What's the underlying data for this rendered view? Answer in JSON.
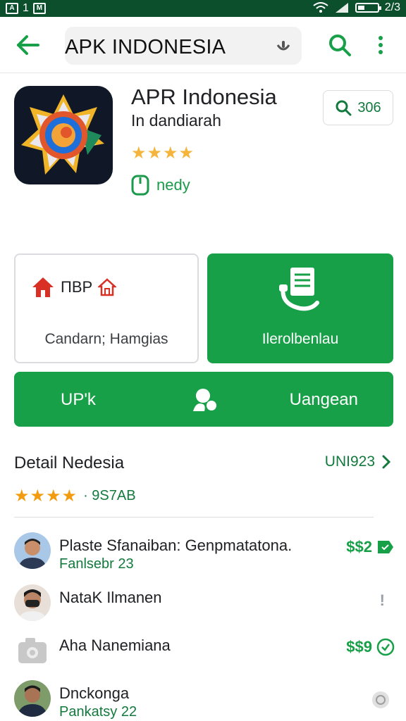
{
  "status_bar": {
    "left_text": "1",
    "time": "2/3",
    "battery_level": 0.35
  },
  "app_bar": {
    "search_query": "APK INDONESIA",
    "back_icon": "arrow-left-icon",
    "mic_icon": "mic-icon",
    "search_icon": "search-icon",
    "more_icon": "more-vert-icon"
  },
  "app": {
    "title": "APR Indonesia",
    "subtitle": "In dandiarah",
    "rating_stars": 4,
    "stars_text": "★★★★",
    "ready_text": "nedy",
    "size_label": "306"
  },
  "cards": {
    "left_brand": "ΠΒΡ",
    "left_caption": "Candarn; Hamgias",
    "right_caption": "Ilerolbenlau"
  },
  "wide_button": {
    "left_label": "UP'k",
    "right_label": "Uangean"
  },
  "details": {
    "title": "Detail Nedesia",
    "link_label": "UNI923",
    "stars_text": "★★★★",
    "rating_count": "· 9S7AB"
  },
  "reviews": [
    {
      "name": "Plaste Sfanaiban: Genpmatatona.",
      "sub": "Fanlsebr 23",
      "action": "$$2",
      "action_icon": "flag-icon"
    },
    {
      "name": "NataK Ilmanen",
      "sub": "",
      "action": "!",
      "action_icon": "alert-icon"
    },
    {
      "name": "Aha Nanemiana",
      "sub": "",
      "action": "$$9",
      "action_icon": "check-circle-icon"
    },
    {
      "name": "Dnckonga",
      "sub": "Pankatsy 22",
      "action": "",
      "action_icon": "circle-icon"
    }
  ],
  "colors": {
    "accent_green": "#17a047",
    "dark_green": "#137a3e",
    "star": "#f5b43a"
  }
}
